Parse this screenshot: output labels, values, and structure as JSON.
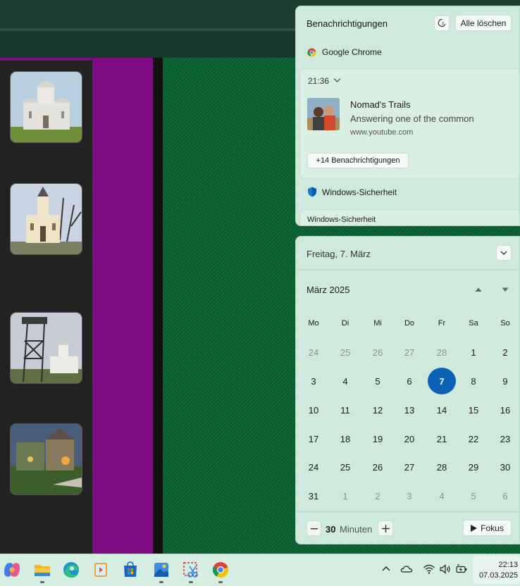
{
  "notifications": {
    "title": "Benachrichtigungen",
    "clear_all": "Alle löschen",
    "groups": [
      {
        "app": "Google Chrome",
        "card": {
          "time": "21:36",
          "title": "Nomad's Trails",
          "body": "Answering one of the common",
          "source": "www.youtube.com",
          "more": "+14 Benachrichtigungen"
        }
      },
      {
        "app": "Windows-Sicherheit",
        "card": {
          "title": "Windows-Sicherheit"
        }
      }
    ]
  },
  "calendar": {
    "date_header": "Freitag, 7. März",
    "month": "März 2025",
    "weekdays": [
      "Mo",
      "Di",
      "Mi",
      "Do",
      "Fr",
      "Sa",
      "So"
    ],
    "weeks": [
      [
        "24",
        "25",
        "26",
        "27",
        "28",
        "1",
        "2"
      ],
      [
        "3",
        "4",
        "5",
        "6",
        "7",
        "8",
        "9"
      ],
      [
        "10",
        "11",
        "12",
        "13",
        "14",
        "15",
        "16"
      ],
      [
        "17",
        "18",
        "19",
        "20",
        "21",
        "22",
        "23"
      ],
      [
        "24",
        "25",
        "26",
        "27",
        "28",
        "29",
        "30"
      ],
      [
        "31",
        "1",
        "2",
        "3",
        "4",
        "5",
        "6"
      ]
    ],
    "today": "7",
    "focus": {
      "value": "30",
      "unit": "Minuten",
      "button": "Fokus"
    }
  },
  "taskbar": {
    "apps": [
      "copilot-icon",
      "file-explorer-icon",
      "edge-icon",
      "media-player-icon",
      "store-icon",
      "photos-icon",
      "snipping-tool-icon",
      "chrome-icon"
    ],
    "tray": [
      "chevron-up-icon",
      "onedrive-icon",
      "wifi-icon",
      "volume-icon",
      "battery-icon"
    ],
    "time": "22:13",
    "date": "07.03.2025"
  },
  "colors": {
    "accent": "#0a61b5",
    "panel": "#cfe9dc",
    "purple": "#7d0b84"
  }
}
